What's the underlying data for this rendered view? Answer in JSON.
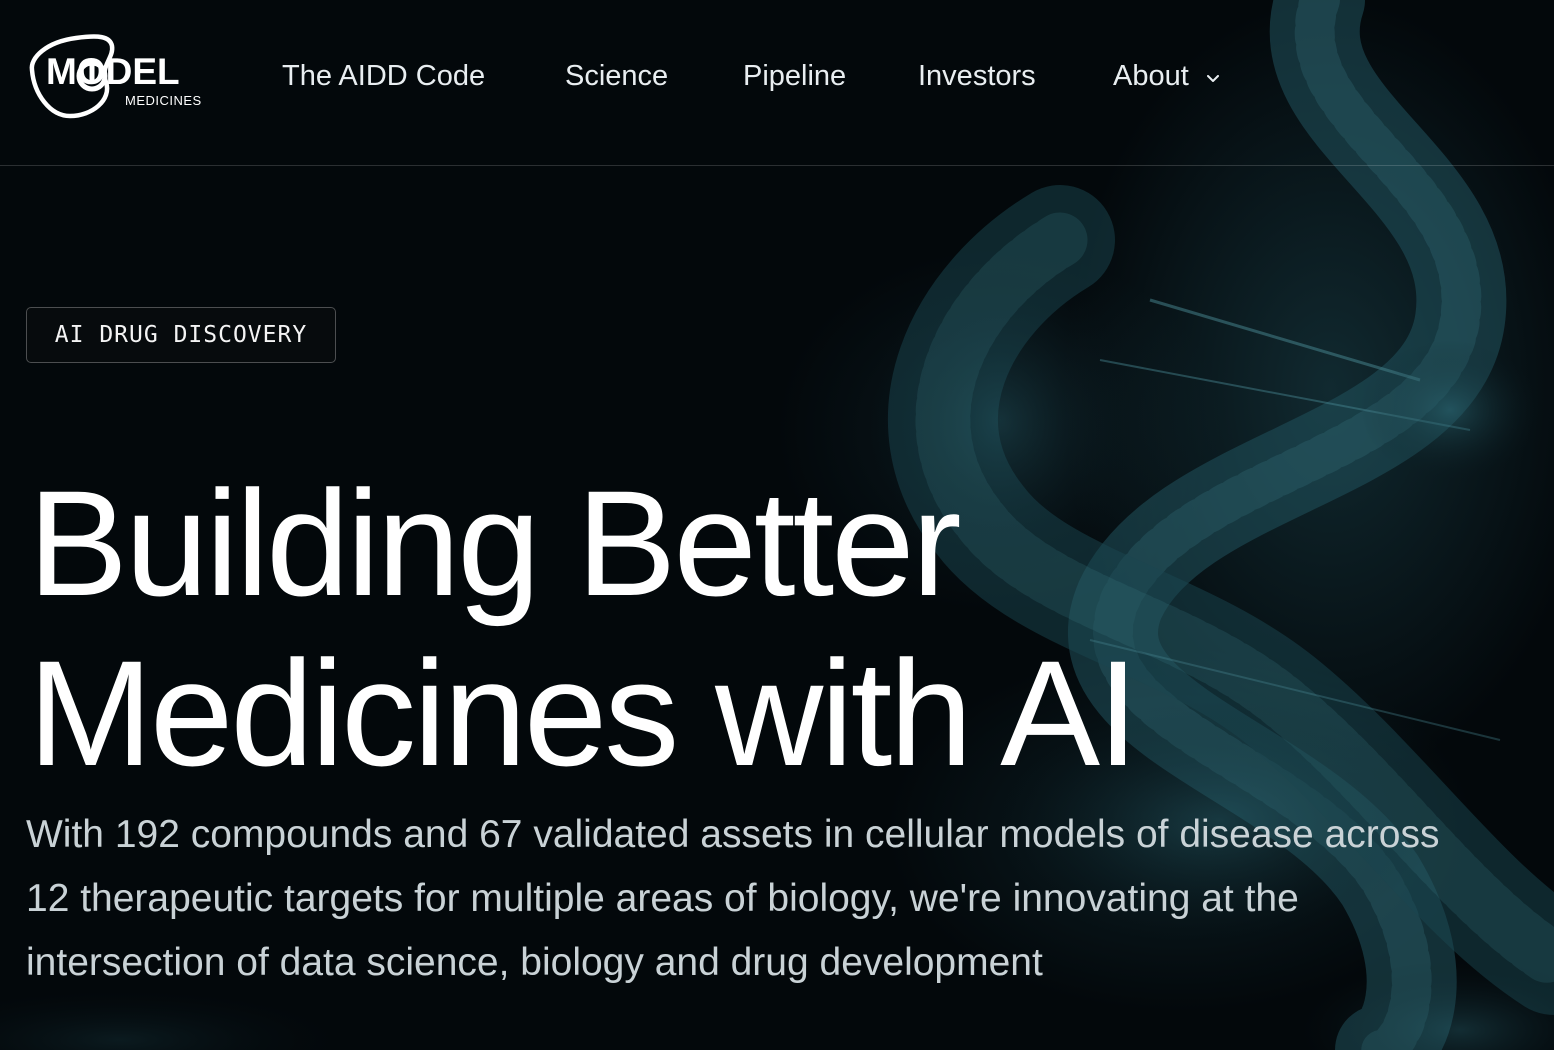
{
  "brand": {
    "name": "MODEL",
    "subtitle": "MEDICINES"
  },
  "nav": {
    "items": [
      {
        "label": "The AIDD Code"
      },
      {
        "label": "Science"
      },
      {
        "label": "Pipeline"
      },
      {
        "label": "Investors"
      },
      {
        "label": "About",
        "icon": "chevron-down-icon"
      }
    ]
  },
  "hero": {
    "tag": "AI DRUG DISCOVERY",
    "headline_line1": "Building Better",
    "headline_line2": "Medicines with AI",
    "description": "With 192 compounds and 67 validated assets in cellular models of disease across 12 therapeutic targets for multiple areas of biology, we're innovating at the intersection of data science, biology and drug development"
  },
  "colors": {
    "background": "#03080b",
    "accent_teal": "#1f5560",
    "text_primary": "#ffffff",
    "text_secondary": "#c9d2d6"
  }
}
